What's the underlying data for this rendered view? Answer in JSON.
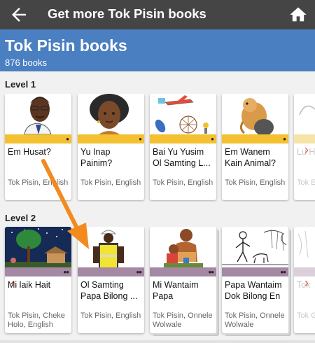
{
  "appbar": {
    "title": "Get more Tok Pisin books",
    "back_icon": "back-arrow-icon",
    "home_icon": "home-icon",
    "background": "#454545"
  },
  "header": {
    "title": "Tok Pisin books",
    "count": "876 books",
    "background": "#4a7fc1"
  },
  "levels": [
    {
      "label": "Level 1",
      "bar_color": "#f3c030",
      "books": [
        {
          "title": "Em Husat?",
          "languages": "Tok Pisin, English"
        },
        {
          "title": "Yu Inap Painim?",
          "languages": "Tok Pisin, English"
        },
        {
          "title": "Bai Yu Yusim Ol Samting L...",
          "languages": "Tok Pisin, English"
        },
        {
          "title": "Em Wanem Kain Animal?",
          "languages": "Tok Pisin, English"
        },
        {
          "title": "Lu Hap",
          "languages": "Tok Englis"
        }
      ]
    },
    {
      "label": "Level 2",
      "bar_color": "#a588a4",
      "books": [
        {
          "title": "Mi laik Hait",
          "languages": "Tok Pisin, Cheke Holo, English"
        },
        {
          "title": "Ol Samting Papa Bilong ...",
          "languages": "Tok Pisin, English"
        },
        {
          "title": "Mi Wantaim Papa",
          "languages": "Tok Pisin, Onnele Wolwale"
        },
        {
          "title": "Papa Wantaim Dok Bilong En",
          "languages": "Tok Pisin, Onnele Wolwale"
        },
        {
          "title": "Tok",
          "languages": "Tok Goin"
        }
      ]
    }
  ],
  "colors": {
    "annotation_arrow": "#f28a1e",
    "scroll_chevron": "#e05a4e"
  }
}
